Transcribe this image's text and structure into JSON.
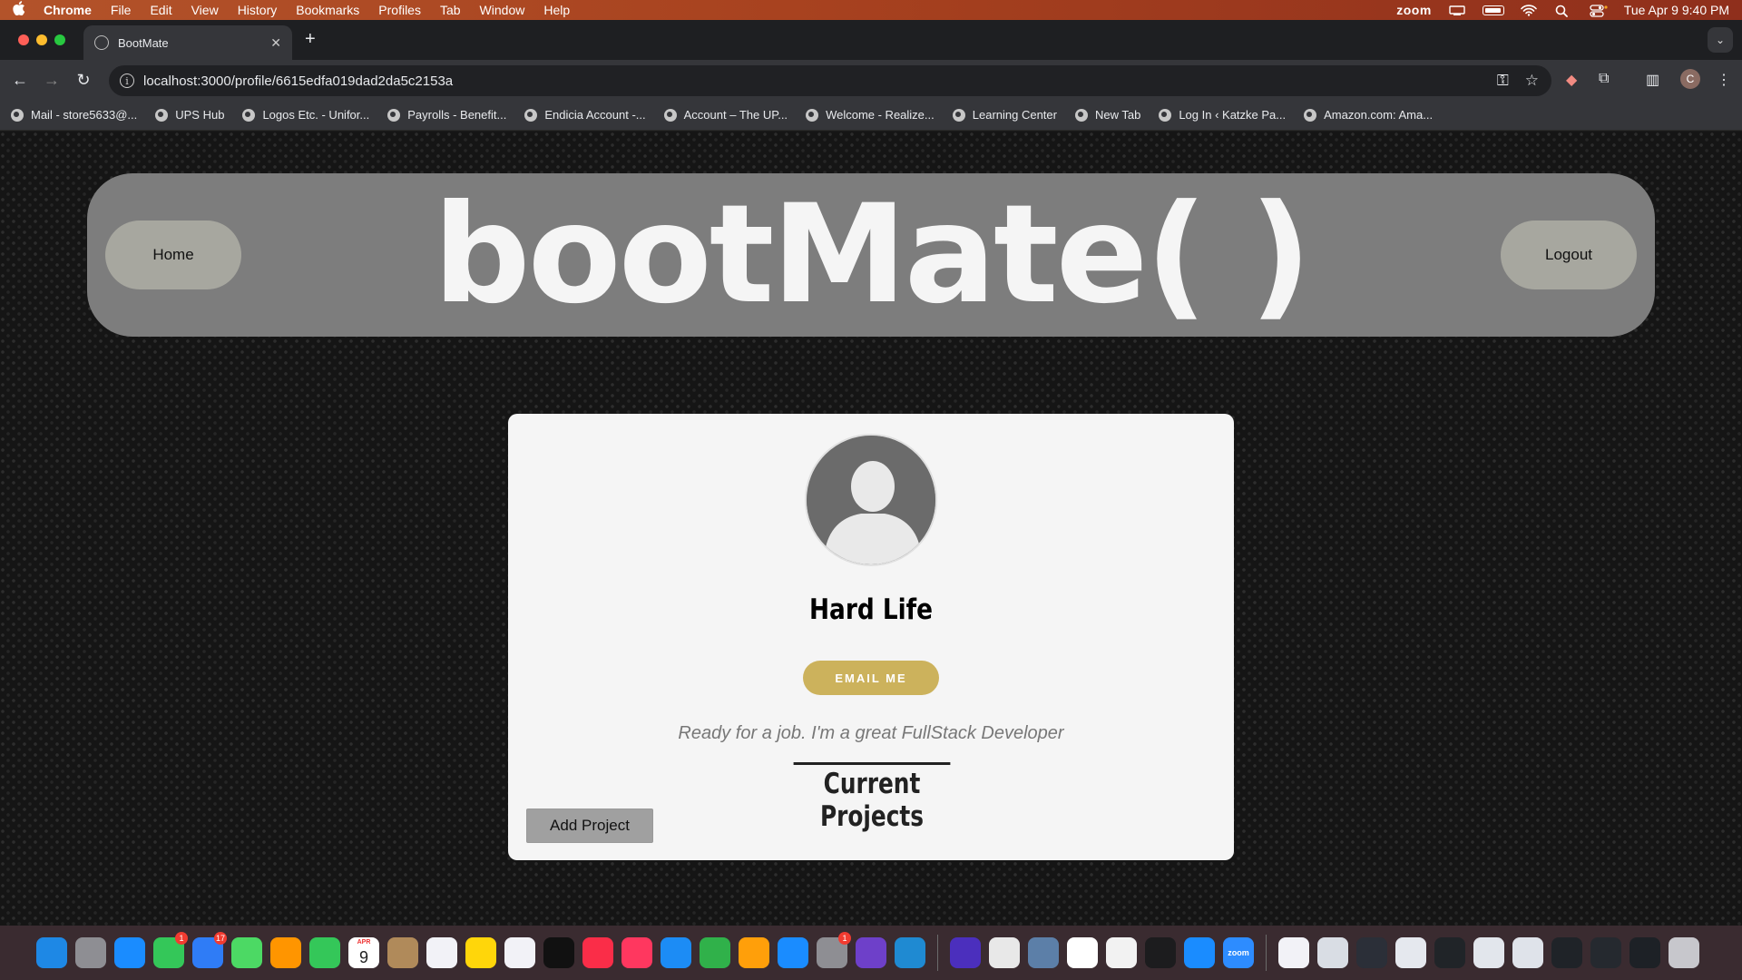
{
  "menubar": {
    "app_name": "Chrome",
    "menus": [
      "File",
      "Edit",
      "View",
      "History",
      "Bookmarks",
      "Profiles",
      "Tab",
      "Window",
      "Help"
    ],
    "zoom_label": "zoom",
    "datetime": "Tue Apr 9  9:40 PM"
  },
  "browser": {
    "tab_title": "BootMate",
    "url": "localhost:3000/profile/6615edfa019dad2da5c2153a",
    "bookmarks": [
      "Mail - store5633@...",
      "UPS Hub",
      "Logos Etc. - Unifor...",
      "Payrolls - Benefit...",
      "Endicia Account -...",
      "Account – The UP...",
      "Welcome - Realize...",
      "Learning Center",
      "New Tab",
      "Log In ‹ Katzke Pa...",
      "Amazon.com: Ama..."
    ],
    "profile_initial": "C"
  },
  "header": {
    "home_label": "Home",
    "logo_text": "bootMate( )",
    "logout_label": "Logout"
  },
  "profile": {
    "name": "Hard Life",
    "email_button": "EMAIL ME",
    "bio": "Ready for a job. I'm a great FullStack Developer",
    "projects_title": "Current Projects",
    "add_project_label": "Add Project"
  },
  "dock": {
    "calendar_month": "APR",
    "calendar_day": "9",
    "messages_badge": "1",
    "mail_badge": "17",
    "settings_badge": "1",
    "zoom_label": "zoom",
    "apps": [
      {
        "name": "finder-icon",
        "color": "#1e88e5"
      },
      {
        "name": "launchpad-icon",
        "color": "#8e8e93"
      },
      {
        "name": "safari-icon",
        "color": "#1a8cff"
      },
      {
        "name": "messages-icon",
        "color": "#34c759"
      },
      {
        "name": "mail-icon",
        "color": "#2f7cf6"
      },
      {
        "name": "maps-icon",
        "color": "#4cd964"
      },
      {
        "name": "photos-icon",
        "color": "#ff9500"
      },
      {
        "name": "facetime-icon",
        "color": "#34c759"
      },
      {
        "name": "calendar-icon",
        "color": "#ffffff"
      },
      {
        "name": "contacts-icon",
        "color": "#b08a5a"
      },
      {
        "name": "reminders-icon",
        "color": "#f2f2f7"
      },
      {
        "name": "notes-icon",
        "color": "#ffd60a"
      },
      {
        "name": "freeform-icon",
        "color": "#f2f2f7"
      },
      {
        "name": "tv-icon",
        "color": "#111111"
      },
      {
        "name": "music-icon",
        "color": "#fa2d48"
      },
      {
        "name": "news-icon",
        "color": "#ff375f"
      },
      {
        "name": "keynote-icon",
        "color": "#1c8cf5"
      },
      {
        "name": "numbers-icon",
        "color": "#30b14a"
      },
      {
        "name": "pages-icon",
        "color": "#ff9f0a"
      },
      {
        "name": "app-store-icon",
        "color": "#1a8cff"
      },
      {
        "name": "system-settings-icon",
        "color": "#8e8e93"
      },
      {
        "name": "github-icon",
        "color": "#6e40c9"
      },
      {
        "name": "vscode-icon",
        "color": "#1f8ad2"
      },
      {
        "name": "separator"
      },
      {
        "name": "proton-vpn-icon",
        "color": "#4b2fbd"
      },
      {
        "name": "chrome-icon",
        "color": "#e8e8e8"
      },
      {
        "name": "preview-icon",
        "color": "#5c7fa8"
      },
      {
        "name": "mongodb-compass-icon",
        "color": "#ffffff"
      },
      {
        "name": "textedit-icon",
        "color": "#f2f2f2"
      },
      {
        "name": "terminal-icon",
        "color": "#1c1c1e"
      },
      {
        "name": "bluetooth-icon",
        "color": "#1a8cff"
      },
      {
        "name": "zoom-icon",
        "color": "#2d8cff"
      },
      {
        "name": "separator"
      },
      {
        "name": "document-icon",
        "color": "#f2f2f7"
      },
      {
        "name": "recent-window-icon",
        "color": "#d9dde4"
      },
      {
        "name": "recent-window-icon",
        "color": "#2b2f38"
      },
      {
        "name": "recent-window-icon",
        "color": "#e5e8ee"
      },
      {
        "name": "recent-window-icon",
        "color": "#202428"
      },
      {
        "name": "recent-window-icon",
        "color": "#e2e6ec"
      },
      {
        "name": "recent-window-icon",
        "color": "#dfe3ea"
      },
      {
        "name": "recent-window-icon",
        "color": "#1f2328"
      },
      {
        "name": "recent-window-icon",
        "color": "#25292f"
      },
      {
        "name": "recent-window-icon",
        "color": "#1d2126"
      },
      {
        "name": "trash-icon",
        "color": "#c7c7cc"
      }
    ]
  },
  "colors": {
    "header_bg": "#7d7d7d",
    "header_button_bg": "#a7a79f",
    "email_button_bg": "#ccb25c",
    "add_button_bg": "#a0a0a0",
    "card_bg": "#f5f5f5"
  }
}
